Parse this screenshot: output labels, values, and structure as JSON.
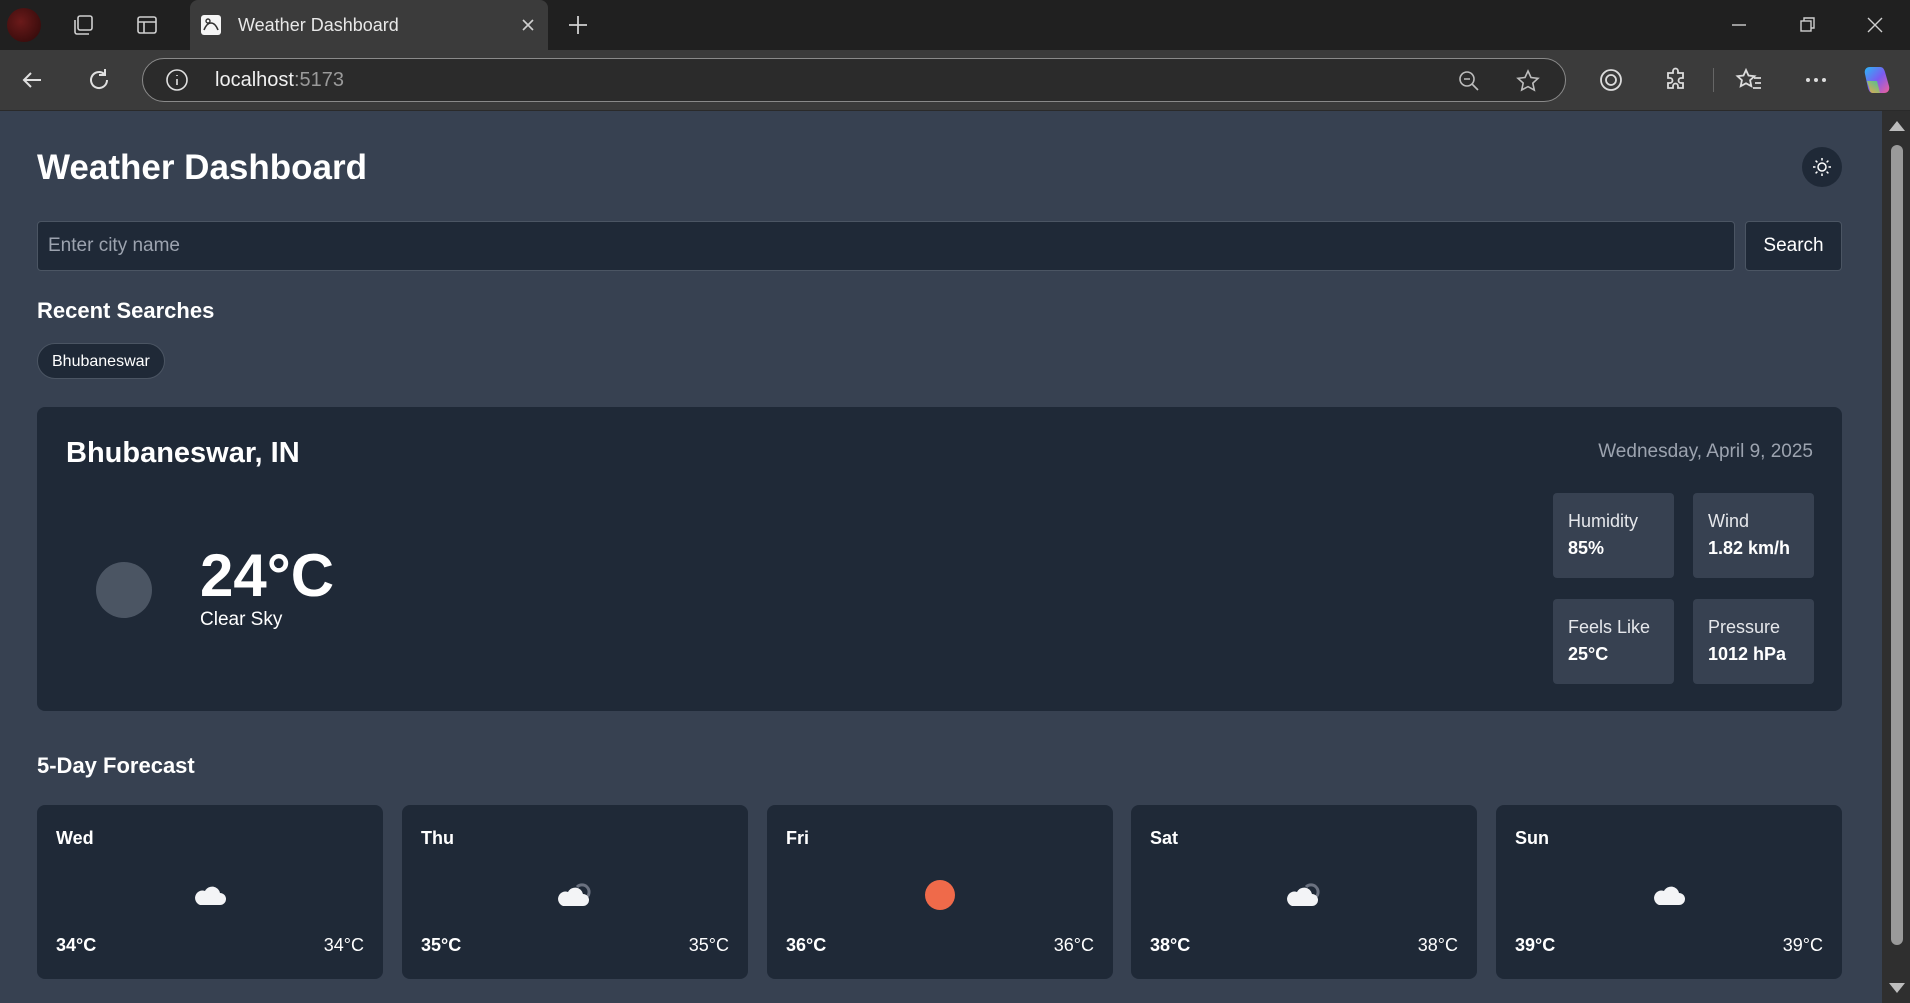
{
  "browser": {
    "tab_title": "Weather Dashboard",
    "url_host": "localhost",
    "url_port": ":5173"
  },
  "app": {
    "title": "Weather Dashboard",
    "search": {
      "placeholder": "Enter city name",
      "value": "",
      "button_label": "Search"
    },
    "recent": {
      "heading": "Recent Searches",
      "items": [
        "Bhubaneswar"
      ]
    },
    "current": {
      "location": "Bhubaneswar, IN",
      "date": "Wednesday, April 9, 2025",
      "temperature": "24°C",
      "description": "Clear Sky",
      "stats": {
        "humidity": {
          "label": "Humidity",
          "value": "85%"
        },
        "wind": {
          "label": "Wind",
          "value": "1.82 km/h"
        },
        "feels_like": {
          "label": "Feels Like",
          "value": "25°C"
        },
        "pressure": {
          "label": "Pressure",
          "value": "1012 hPa"
        }
      }
    },
    "forecast": {
      "heading": "5-Day Forecast",
      "days": [
        {
          "day": "Wed",
          "high": "34°C",
          "low": "34°C",
          "icon": "cloud-icon"
        },
        {
          "day": "Thu",
          "high": "35°C",
          "low": "35°C",
          "icon": "cloudy-night-icon"
        },
        {
          "day": "Fri",
          "high": "36°C",
          "low": "36°C",
          "icon": "sun-icon"
        },
        {
          "day": "Sat",
          "high": "38°C",
          "low": "38°C",
          "icon": "cloudy-night-icon"
        },
        {
          "day": "Sun",
          "high": "39°C",
          "low": "39°C",
          "icon": "cloud-icon"
        }
      ]
    }
  },
  "colors": {
    "page_bg": "#374151",
    "card_bg": "#1f2937",
    "stat_bg": "#374151",
    "sun": "#ef6a4a"
  }
}
